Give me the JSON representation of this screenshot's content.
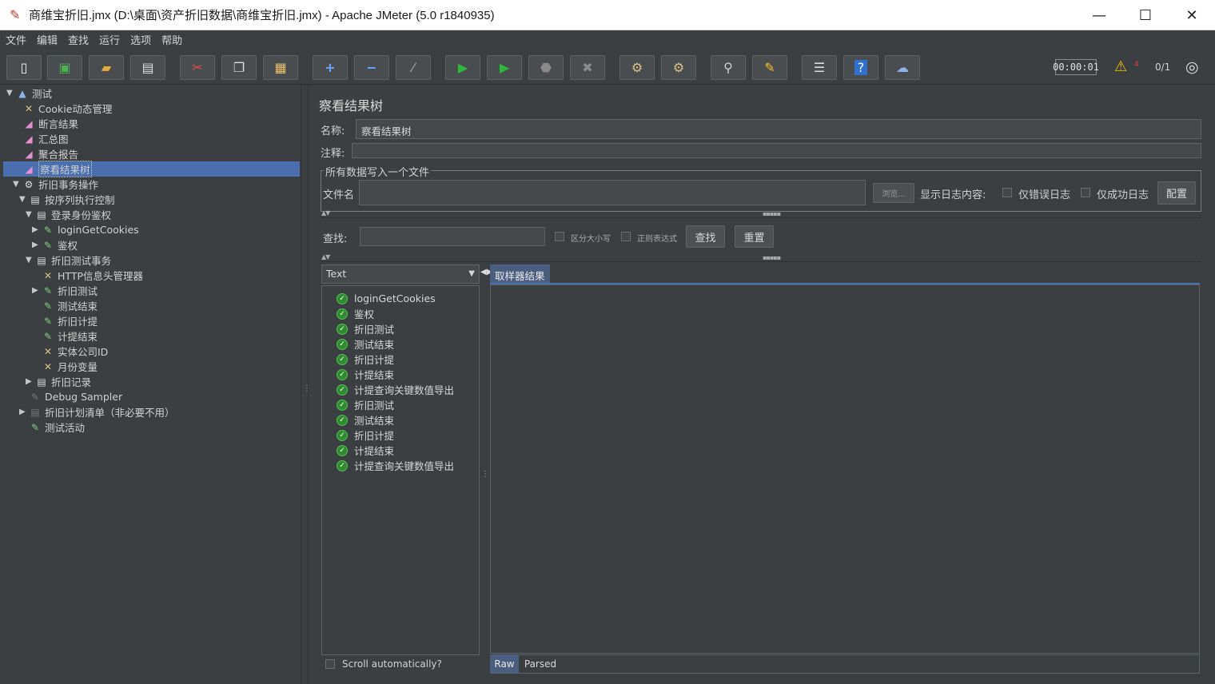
{
  "window": {
    "title": "商维宝折旧.jmx (D:\\桌面\\资产折旧数据\\商维宝折旧.jmx) - Apache JMeter (5.0 r1840935)",
    "minimize": "—",
    "maximize": "☐",
    "close": "✕"
  },
  "menu": [
    "文件",
    "编辑",
    "查找",
    "运行",
    "选项",
    "帮助"
  ],
  "toolbar": {
    "icons": [
      "new-icon",
      "templates-icon",
      "open-icon",
      "save-icon",
      "cut-icon",
      "copy-icon",
      "paste-icon",
      "expand-icon",
      "collapse-icon",
      "toggle-icon",
      "start-icon",
      "start-no-pause-icon",
      "stop-icon",
      "shutdown-icon",
      "clear-icon",
      "clear-all-icon",
      "search-icon",
      "reset-search-icon",
      "function-helper-icon",
      "help-icon",
      "remote-icon"
    ],
    "timer": "00:00:01",
    "warning_count": "4",
    "threads": "0/1"
  },
  "tree": [
    {
      "label": "测试",
      "level": 0,
      "arrow": "▼",
      "icon": "test-plan-icon"
    },
    {
      "label": "Cookie动态管理",
      "level": 1,
      "arrow": "",
      "icon": "config-icon"
    },
    {
      "label": "断言结果",
      "level": 1,
      "arrow": "",
      "icon": "listener-icon"
    },
    {
      "label": "汇总图",
      "level": 1,
      "arrow": "",
      "icon": "listener-icon"
    },
    {
      "label": "聚合报告",
      "level": 1,
      "arrow": "",
      "icon": "listener-icon"
    },
    {
      "label": "察看结果树",
      "level": 1,
      "arrow": "",
      "icon": "listener-icon",
      "selected": true
    },
    {
      "label": "折旧事务操作",
      "level": 1,
      "arrow": "▼",
      "icon": "thread-group-icon"
    },
    {
      "label": "按序列执行控制",
      "level": 2,
      "arrow": "▼",
      "icon": "controller-icon"
    },
    {
      "label": "登录身份鉴权",
      "level": 3,
      "arrow": "▼",
      "icon": "controller-icon"
    },
    {
      "label": "loginGetCookies",
      "level": 4,
      "arrow": "▶",
      "icon": "sampler-icon"
    },
    {
      "label": "鉴权",
      "level": 4,
      "arrow": "▶",
      "icon": "sampler-icon"
    },
    {
      "label": "折旧测试事务",
      "level": 3,
      "arrow": "▼",
      "icon": "controller-icon"
    },
    {
      "label": "HTTP信息头管理器",
      "level": 4,
      "arrow": "",
      "icon": "config-icon"
    },
    {
      "label": "折旧测试",
      "level": 4,
      "arrow": "▶",
      "icon": "sampler-icon"
    },
    {
      "label": "测试结束",
      "level": 4,
      "arrow": "",
      "icon": "sampler-icon"
    },
    {
      "label": "折旧计提",
      "level": 4,
      "arrow": "",
      "icon": "sampler-icon"
    },
    {
      "label": "计提结束",
      "level": 4,
      "arrow": "",
      "icon": "sampler-icon"
    },
    {
      "label": "实体公司ID",
      "level": 4,
      "arrow": "",
      "icon": "config-icon"
    },
    {
      "label": "月份变量",
      "level": 4,
      "arrow": "",
      "icon": "config-icon"
    },
    {
      "label": "折旧记录",
      "level": 3,
      "arrow": "▶",
      "icon": "controller-icon"
    },
    {
      "label": "Debug Sampler",
      "level": 2,
      "arrow": "",
      "icon": "sampler-icon",
      "disabled": true
    },
    {
      "label": "折旧计划清单（非必要不用）",
      "level": 2,
      "arrow": "▶",
      "icon": "controller-icon",
      "disabled": true
    },
    {
      "label": "测试活动",
      "level": 2,
      "arrow": "",
      "icon": "sampler-icon"
    }
  ],
  "panel": {
    "title": "察看结果树",
    "name_label": "名称:",
    "name_value": "察看结果树",
    "comment_label": "注释:",
    "comment_value": "",
    "file_group_label": "所有数据写入一个文件",
    "filename_label": "文件名",
    "filename_value": "",
    "browse_label": "浏览...",
    "log_label": "显示日志内容:",
    "errors_only_label": "仅错误日志",
    "success_only_label": "仅成功日志",
    "configure_label": "配置",
    "search_label": "查找:",
    "search_value": "",
    "case_label": "区分大小写",
    "regex_label": "正则表达式",
    "find_button": "查找",
    "reset_button": "重置",
    "renderer_value": "Text",
    "sampler_tab": "取样器结果",
    "raw_tab": "Raw",
    "parsed_tab": "Parsed",
    "scroll_label": "Scroll automatically?"
  },
  "results": [
    "loginGetCookies",
    "鉴权",
    "折旧测试",
    "测试结束",
    "折旧计提",
    "计提结束",
    "计提查询关键数值导出",
    "折旧测试",
    "测试结束",
    "折旧计提",
    "计提结束",
    "计提查询关键数值导出"
  ]
}
